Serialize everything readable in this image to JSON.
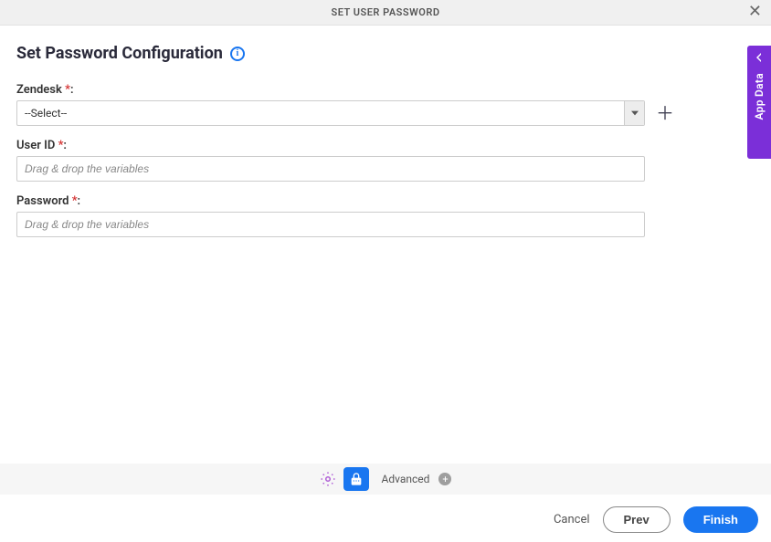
{
  "header": {
    "title": "SET USER PASSWORD"
  },
  "page": {
    "title": "Set Password Configuration"
  },
  "side_tab": {
    "label": "App Data"
  },
  "fields": {
    "zendesk": {
      "label": "Zendesk",
      "selected": "--Select--"
    },
    "user_id": {
      "label": "User ID",
      "placeholder": "Drag & drop the variables"
    },
    "password": {
      "label": "Password",
      "placeholder": "Drag & drop the variables"
    }
  },
  "step_bar": {
    "advanced_label": "Advanced"
  },
  "footer": {
    "cancel": "Cancel",
    "prev": "Prev",
    "finish": "Finish"
  }
}
